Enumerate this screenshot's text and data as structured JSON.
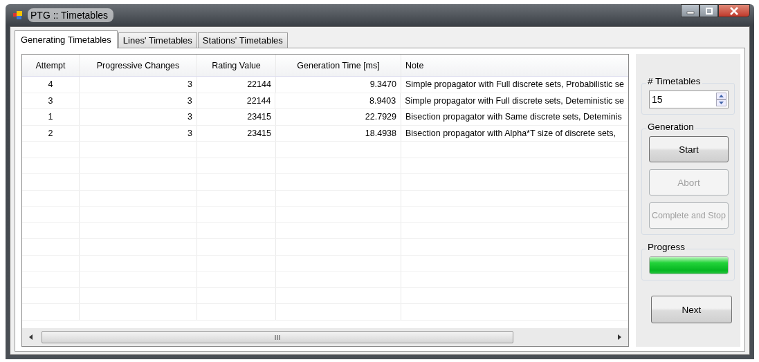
{
  "window": {
    "title": "PTG :: Timetables"
  },
  "tabs": [
    {
      "label": "Generating Timetables",
      "selected": true
    },
    {
      "label": "Lines' Timetables",
      "selected": false
    },
    {
      "label": "Stations' Timetables",
      "selected": false
    }
  ],
  "table": {
    "columns": [
      "Attempt",
      "Progressive Changes",
      "Rating Value",
      "Generation Time [ms]",
      "Note"
    ],
    "rows": [
      [
        "4",
        "3",
        "22144",
        "9.3470",
        "Simple propagator with Full discrete sets, Probabilistic se"
      ],
      [
        "3",
        "3",
        "22144",
        "8.9403",
        "Simple propagator with Full discrete sets, Deteministic se"
      ],
      [
        "1",
        "3",
        "23415",
        "22.7929",
        "Bisection propagator with Same discrete sets, Deteminis"
      ],
      [
        "2",
        "3",
        "23415",
        "18.4938",
        "Bisection propagator with Alpha*T size of discrete sets,"
      ]
    ]
  },
  "timetables": {
    "label": "# Timetables",
    "value": "15"
  },
  "generation": {
    "label": "Generation",
    "buttons": [
      {
        "label": "Start",
        "disabled": false
      },
      {
        "label": "Abort",
        "disabled": true
      },
      {
        "label": "Complete and Stop",
        "disabled": true
      }
    ]
  },
  "progress": {
    "label": "Progress",
    "level": 1
  },
  "next_button": "Next"
}
